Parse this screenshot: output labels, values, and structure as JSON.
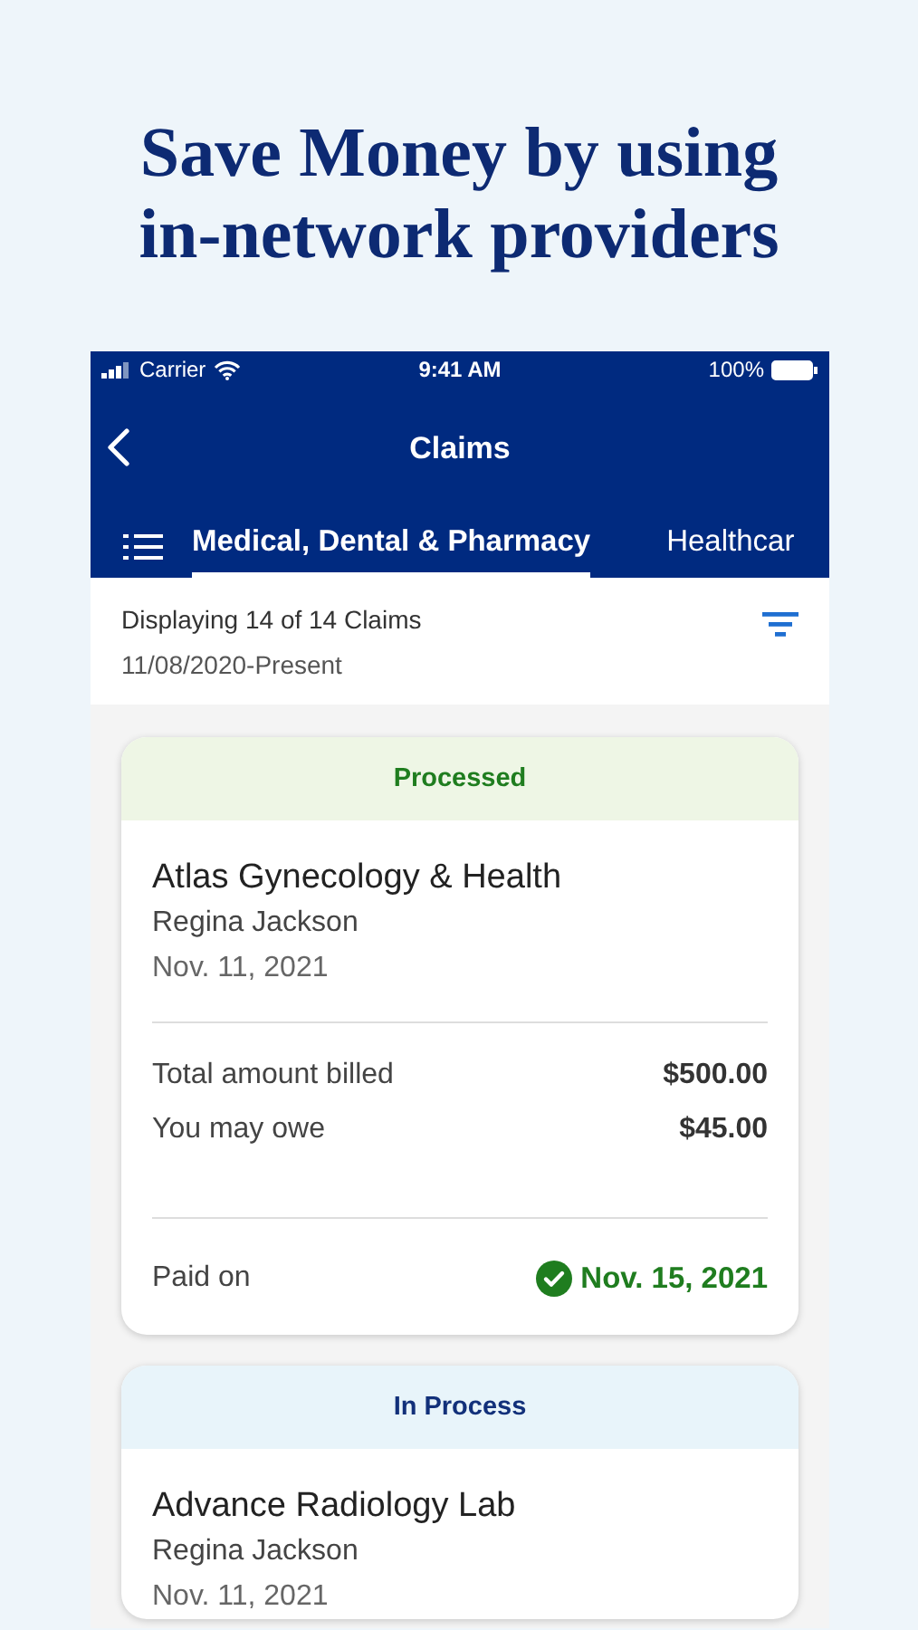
{
  "headline": "Save Money by using in-network providers",
  "status_bar": {
    "carrier": "Carrier",
    "time": "9:41 AM",
    "battery": "100%"
  },
  "nav": {
    "title": "Claims"
  },
  "tabs": [
    {
      "label": "Medical, Dental & Pharmacy",
      "selected": true
    },
    {
      "label": "Healthcar",
      "selected": false
    }
  ],
  "summary": {
    "count": "Displaying 14 of 14 Claims",
    "range": "11/08/2020-Present"
  },
  "claims": [
    {
      "status": "Processed",
      "kind": "processed",
      "provider": "Atlas Gynecology & Health",
      "patient": "Regina Jackson",
      "date": "Nov. 11, 2021",
      "amounts": [
        {
          "label": "Total amount billed",
          "value": "$500.00"
        },
        {
          "label": "You may owe",
          "value": "$45.00"
        }
      ],
      "paid": {
        "label": "Paid on",
        "date": "Nov. 15, 2021"
      }
    },
    {
      "status": "In Process",
      "kind": "in_process",
      "provider": "Advance Radiology Lab",
      "patient": "Regina Jackson",
      "date": "Nov. 11, 2021"
    }
  ]
}
